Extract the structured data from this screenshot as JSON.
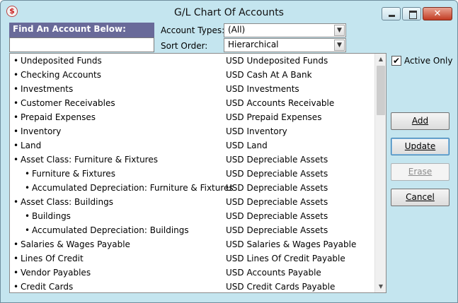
{
  "window": {
    "title": "G/L Chart Of Accounts",
    "app_icon_glyph": "$",
    "close_glyph": "✕"
  },
  "find": {
    "label": "Find An Account Below:",
    "value": ""
  },
  "filters": {
    "account_types_label": "Account Types:",
    "account_types_value": "(All)",
    "sort_order_label": "Sort Order:",
    "sort_order_value": "Hierarchical",
    "dropdown_glyph": "▼"
  },
  "accounts": [
    {
      "name": "Undeposited Funds",
      "type": "USD Undeposited Funds",
      "level": 0
    },
    {
      "name": "Checking Accounts",
      "type": "USD Cash At A Bank",
      "level": 0
    },
    {
      "name": "Investments",
      "type": "USD Investments",
      "level": 0
    },
    {
      "name": "Customer Receivables",
      "type": "USD Accounts Receivable",
      "level": 0
    },
    {
      "name": "Prepaid Expenses",
      "type": "USD Prepaid Expenses",
      "level": 0
    },
    {
      "name": "Inventory",
      "type": "USD Inventory",
      "level": 0
    },
    {
      "name": "Land",
      "type": "USD Land",
      "level": 0
    },
    {
      "name": "Asset Class: Furniture & Fixtures",
      "type": "USD Depreciable Assets",
      "level": 0
    },
    {
      "name": "Furniture & Fixtures",
      "type": "USD Depreciable Assets",
      "level": 1
    },
    {
      "name": "Accumulated Depreciation: Furniture & Fixtures",
      "type": "USD Depreciable Assets",
      "level": 1
    },
    {
      "name": "Asset Class: Buildings",
      "type": "USD Depreciable Assets",
      "level": 0
    },
    {
      "name": "Buildings",
      "type": "USD Depreciable Assets",
      "level": 1
    },
    {
      "name": "Accumulated Depreciation: Buildings",
      "type": "USD Depreciable Assets",
      "level": 1
    },
    {
      "name": "Salaries & Wages Payable",
      "type": "USD Salaries & Wages Payable",
      "level": 0
    },
    {
      "name": "Lines Of Credit",
      "type": "USD Lines Of Credit Payable",
      "level": 0
    },
    {
      "name": "Vendor Payables",
      "type": "USD Accounts Payable",
      "level": 0
    },
    {
      "name": "Credit Cards",
      "type": "USD Credit Cards Payable",
      "level": 0
    }
  ],
  "bullet": "•",
  "options": {
    "active_only_label": "Active Only",
    "active_only_checked": true,
    "check_glyph": "✔"
  },
  "buttons": {
    "add": "Add",
    "update": "Update",
    "erase": "Erase",
    "cancel": "Cancel"
  },
  "scroll": {
    "up_glyph": "▲",
    "down_glyph": "▼"
  }
}
